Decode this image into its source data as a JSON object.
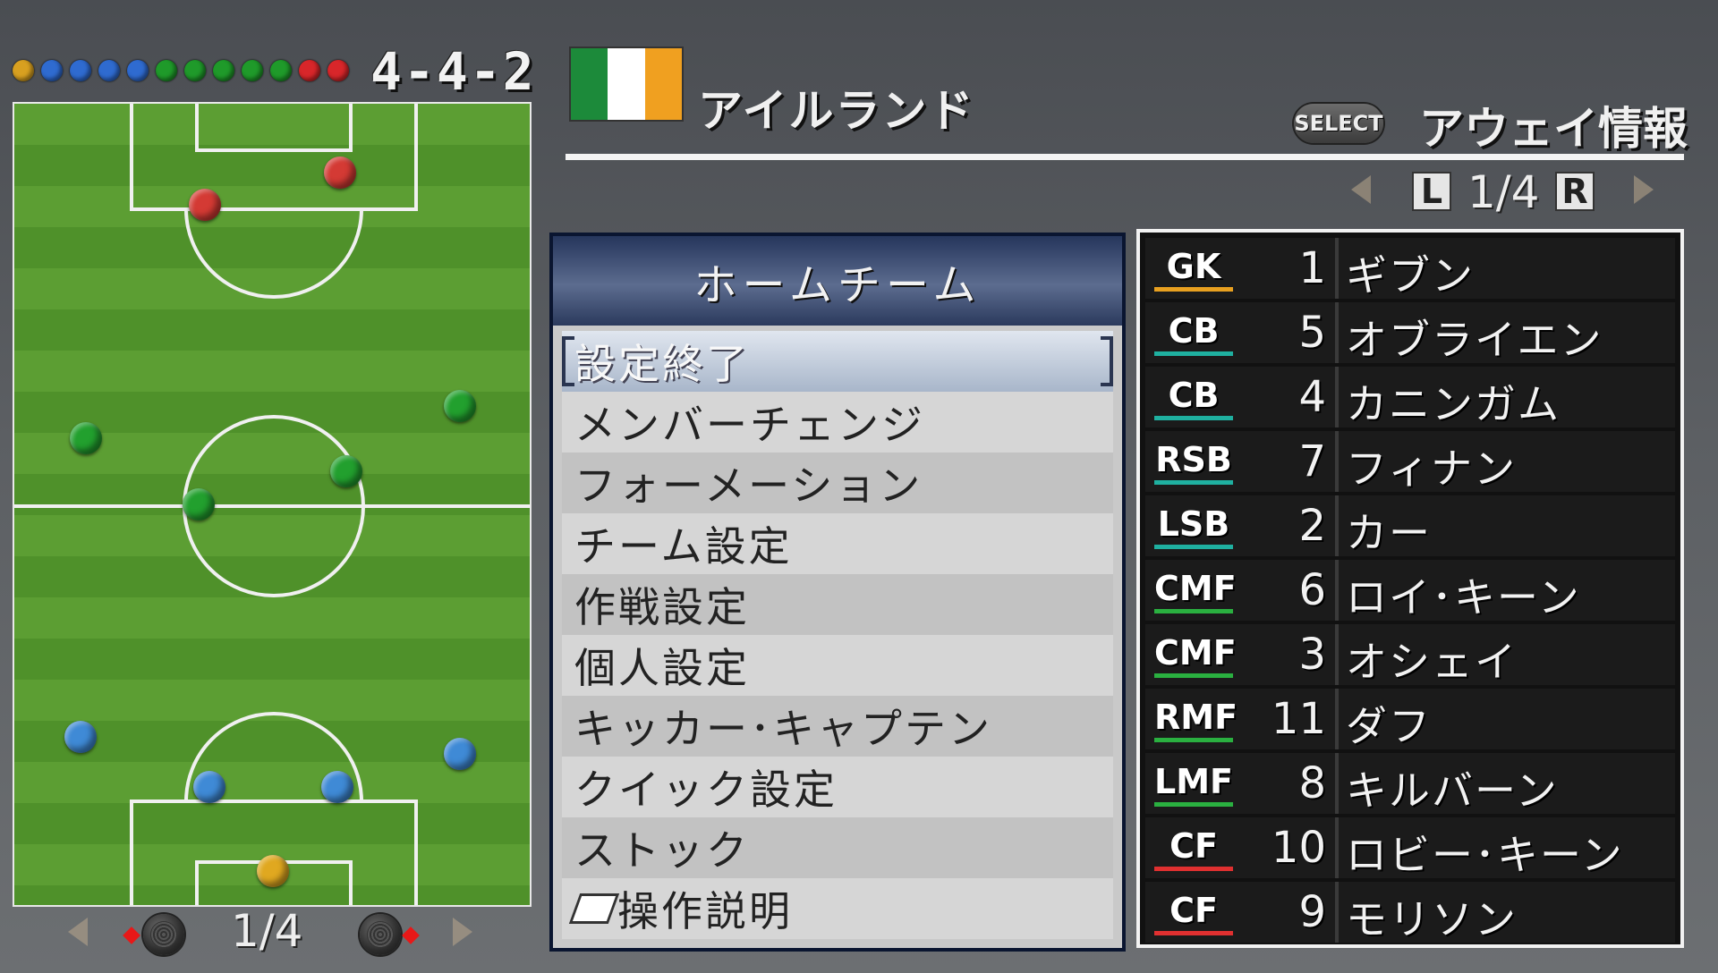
{
  "formation": "4-4-2",
  "formation_dots": [
    {
      "color": "#d8a020"
    },
    {
      "color": "#2f6bd0"
    },
    {
      "color": "#2f6bd0"
    },
    {
      "color": "#2f6bd0"
    },
    {
      "color": "#2f6bd0"
    },
    {
      "color": "#1f9a2a"
    },
    {
      "color": "#1f9a2a"
    },
    {
      "color": "#1f9a2a"
    },
    {
      "color": "#1f9a2a"
    },
    {
      "color": "#1f9a2a"
    },
    {
      "color": "#d8262a"
    },
    {
      "color": "#d8262a"
    }
  ],
  "pitch_pager": {
    "text": "1/4"
  },
  "header": {
    "country": "アイルランド",
    "flag_colors": [
      "#1c8a3a",
      "#ffffff",
      "#f0a020"
    ],
    "select_label": "SELECT",
    "away_info": "アウェイ情報",
    "page_left_key": "L",
    "page_right_key": "R",
    "page_text": "1/4"
  },
  "menu": {
    "title": "ホームチーム",
    "items": [
      {
        "label": "設定終了",
        "selected": true
      },
      {
        "label": "メンバーチェンジ"
      },
      {
        "label": "フォーメーション"
      },
      {
        "label": "チーム設定"
      },
      {
        "label": "作戦設定"
      },
      {
        "label": "個人設定"
      },
      {
        "label": "キッカー･キャプテン"
      },
      {
        "label": "クイック設定"
      },
      {
        "label": "ストック"
      },
      {
        "label": "操作説明",
        "icon": "book-icon"
      }
    ]
  },
  "roster": [
    {
      "pos": "GK",
      "num": "1",
      "name": "ギブン",
      "color": "#e8a020"
    },
    {
      "pos": "CB",
      "num": "5",
      "name": "オブライエン",
      "color": "#1fb0a0"
    },
    {
      "pos": "CB",
      "num": "4",
      "name": "カニンガム",
      "color": "#1fb0a0"
    },
    {
      "pos": "RSB",
      "num": "7",
      "name": "フィナン",
      "color": "#1fb0a0"
    },
    {
      "pos": "LSB",
      "num": "2",
      "name": "カー",
      "color": "#1fb0a0"
    },
    {
      "pos": "CMF",
      "num": "6",
      "name": "ロイ･キーン",
      "color": "#2ab040"
    },
    {
      "pos": "CMF",
      "num": "3",
      "name": "オシェイ",
      "color": "#2ab040"
    },
    {
      "pos": "RMF",
      "num": "11",
      "name": "ダフ",
      "color": "#2ab040"
    },
    {
      "pos": "LMF",
      "num": "8",
      "name": "キルバーン",
      "color": "#2ab040"
    },
    {
      "pos": "CF",
      "num": "10",
      "name": "ロビー･キーン",
      "color": "#e03030"
    },
    {
      "pos": "CF",
      "num": "9",
      "name": "モリソン",
      "color": "#e03030"
    }
  ]
}
